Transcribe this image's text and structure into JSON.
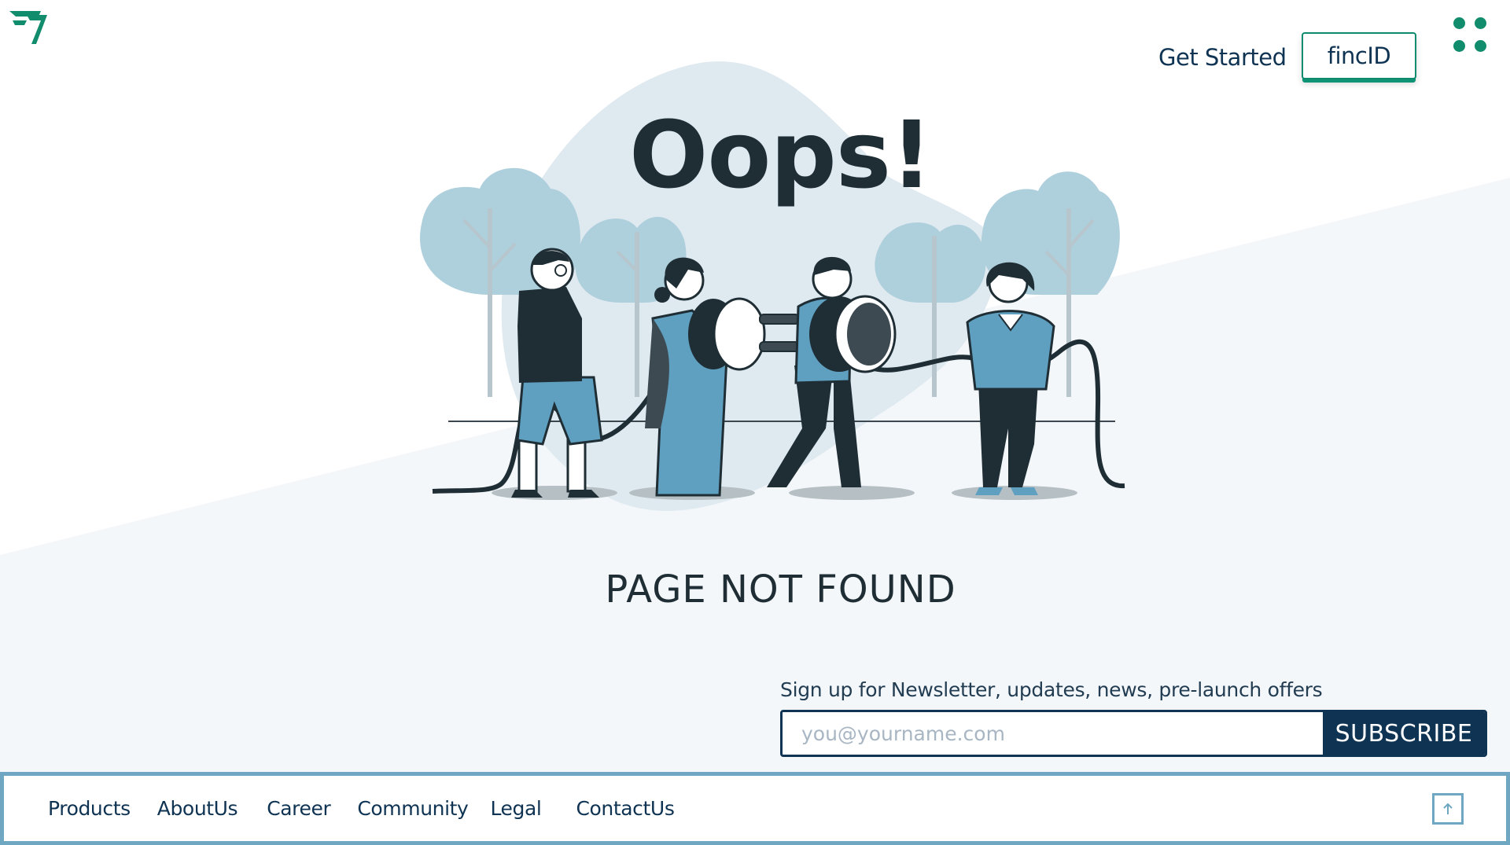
{
  "header": {
    "logo_icon": "fs-logo-icon",
    "get_started_label": "Get Started",
    "fincid_label": "fincID",
    "menu_icon": "grid-dots-icon"
  },
  "main": {
    "headline": "Oops!",
    "subheadline": "PAGE NOT FOUND",
    "illustration": "people-connecting-plug-illustration"
  },
  "newsletter": {
    "label": "Sign up for Newsletter, updates, news, pre-launch offers",
    "email_placeholder": "you@yourname.com",
    "email_value": "",
    "subscribe_label": "SUBSCRIBE"
  },
  "footer": {
    "links": [
      "Products",
      "AboutUs",
      "Career",
      "Community",
      "Legal",
      "ContactUs"
    ],
    "scroll_top_icon": "arrow-up-icon"
  },
  "colors": {
    "brand_green": "#118c6c",
    "navy": "#0f3352",
    "footer_border": "#6fa7c3",
    "bg_tint": "#f3f7fa",
    "blob": "#dfe9f0",
    "figure_blue": "#5f9fc0"
  }
}
